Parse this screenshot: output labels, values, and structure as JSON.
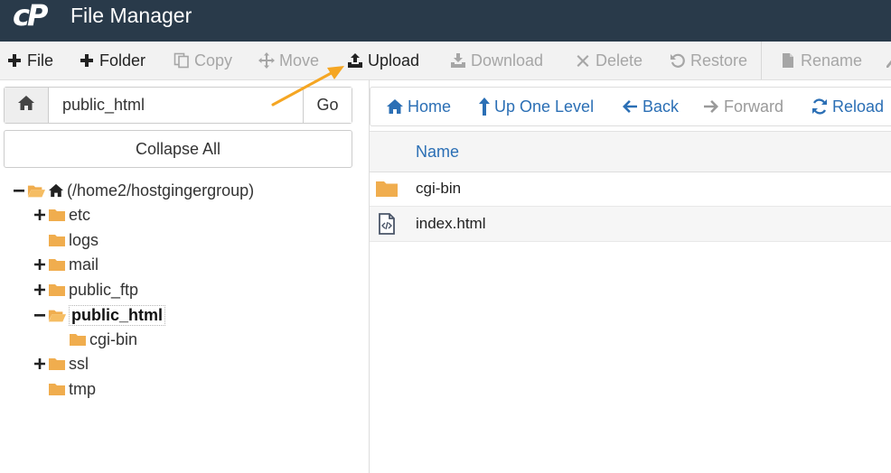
{
  "app": {
    "logo_text": "cP",
    "title": "File Manager"
  },
  "toolbar": {
    "items": [
      {
        "label": "File",
        "icon": "plus-icon",
        "enabled": true
      },
      {
        "label": "Folder",
        "icon": "plus-icon",
        "enabled": true
      },
      {
        "label": "Copy",
        "icon": "copy-icon",
        "enabled": false
      },
      {
        "label": "Move",
        "icon": "move-icon",
        "enabled": false
      },
      {
        "label": "Upload",
        "icon": "upload-icon",
        "enabled": true
      },
      {
        "label": "Download",
        "icon": "download-icon",
        "enabled": false
      },
      {
        "label": "Delete",
        "icon": "times-icon",
        "enabled": false
      },
      {
        "label": "Restore",
        "icon": "undo-icon",
        "enabled": false
      },
      {
        "label": "Rename",
        "icon": "file-icon",
        "enabled": false
      }
    ]
  },
  "left": {
    "path_value": "public_html",
    "go_label": "Go",
    "collapse_label": "Collapse All",
    "tree": [
      {
        "label": "(/home2/hostgingergroup)",
        "toggle": "minus",
        "open": true,
        "home": true
      },
      {
        "label": "etc",
        "toggle": "plus"
      },
      {
        "label": "logs",
        "toggle": ""
      },
      {
        "label": "mail",
        "toggle": "plus"
      },
      {
        "label": "public_ftp",
        "toggle": "plus"
      },
      {
        "label": "public_html",
        "toggle": "minus",
        "open": true,
        "selected": true
      },
      {
        "label": "cgi-bin",
        "toggle": ""
      },
      {
        "label": "ssl",
        "toggle": "plus"
      },
      {
        "label": "tmp",
        "toggle": ""
      }
    ]
  },
  "nav": {
    "items": [
      {
        "label": "Home",
        "icon": "home-icon",
        "enabled": true
      },
      {
        "label": "Up One Level",
        "icon": "level-up-icon",
        "enabled": true
      },
      {
        "label": "Back",
        "icon": "arrow-left-icon",
        "enabled": true
      },
      {
        "label": "Forward",
        "icon": "arrow-right-icon",
        "enabled": false
      },
      {
        "label": "Reload",
        "icon": "refresh-icon",
        "enabled": true
      }
    ]
  },
  "files": {
    "column_name": "Name",
    "rows": [
      {
        "name": "cgi-bin",
        "type": "folder"
      },
      {
        "name": "index.html",
        "type": "html-file"
      }
    ]
  },
  "colors": {
    "header_bg": "#293a4a",
    "link_blue": "#2b6fb5",
    "folder_orange": "#f0ad4e",
    "annotation_arrow": "#f5a623"
  }
}
